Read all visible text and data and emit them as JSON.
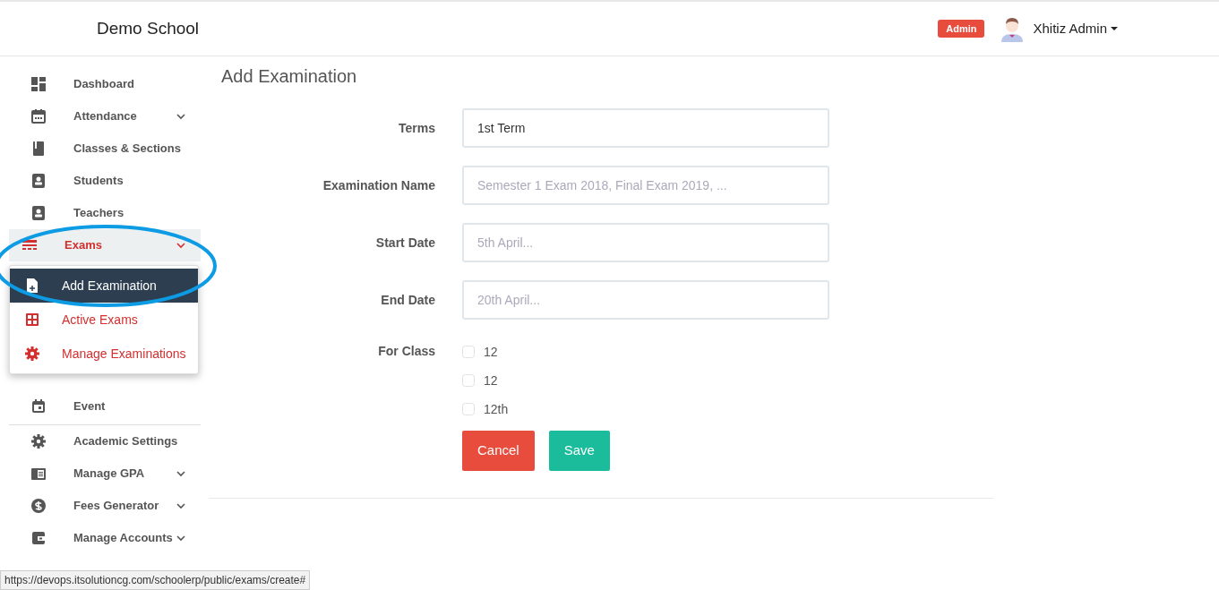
{
  "header": {
    "brand": "Demo School",
    "role_badge": "Admin",
    "user_name": "Xhitiz Admin"
  },
  "sidebar": {
    "items": [
      {
        "label": "Dashboard",
        "kind": "item",
        "expandable": false,
        "selected": false
      },
      {
        "label": "Attendance",
        "kind": "item",
        "expandable": true,
        "selected": false
      },
      {
        "label": "Classes & Sections",
        "kind": "item",
        "expandable": false,
        "selected": false
      },
      {
        "label": "Students",
        "kind": "item",
        "expandable": false,
        "selected": false
      },
      {
        "label": "Teachers",
        "kind": "item",
        "expandable": false,
        "selected": false
      },
      {
        "label": "Exams",
        "kind": "item",
        "expandable": true,
        "selected": true,
        "submenu": [
          {
            "label": "Add Examination",
            "selected": true
          },
          {
            "label": "Active Exams",
            "selected": false
          },
          {
            "label": "Manage Examinations",
            "selected": false
          }
        ]
      },
      {
        "label": "Event",
        "kind": "item",
        "expandable": false,
        "selected": false
      },
      {
        "kind": "divider"
      },
      {
        "label": "Academic Settings",
        "kind": "item",
        "expandable": false,
        "selected": false
      },
      {
        "label": "Manage GPA",
        "kind": "item",
        "expandable": true,
        "selected": false
      },
      {
        "label": "Fees Generator",
        "kind": "item",
        "expandable": true,
        "selected": false
      },
      {
        "label": "Manage Accounts",
        "kind": "item",
        "expandable": true,
        "selected": false
      }
    ]
  },
  "page_title": "Add Examination",
  "form": {
    "fields": [
      {
        "label": "Terms",
        "kind": "select",
        "value": "1st Term"
      },
      {
        "label": "Examination Name",
        "kind": "text",
        "placeholder": "Semester 1 Exam 2018, Final Exam 2019, ..."
      },
      {
        "label": "Start Date",
        "kind": "text",
        "placeholder": "5th April..."
      },
      {
        "label": "End Date",
        "kind": "text",
        "placeholder": "20th April..."
      }
    ],
    "class_label": "For Class",
    "classes": [
      {
        "label": "12",
        "checked": false
      },
      {
        "label": "12",
        "checked": false
      },
      {
        "label": "12th",
        "checked": false
      }
    ],
    "buttons": [
      {
        "label": "Cancel",
        "kind": "danger"
      },
      {
        "label": "Save",
        "kind": "success"
      }
    ]
  },
  "status_bar": {
    "url": "https://devops.itsolutioncg.com/schoolerp/public/exams/create#"
  }
}
